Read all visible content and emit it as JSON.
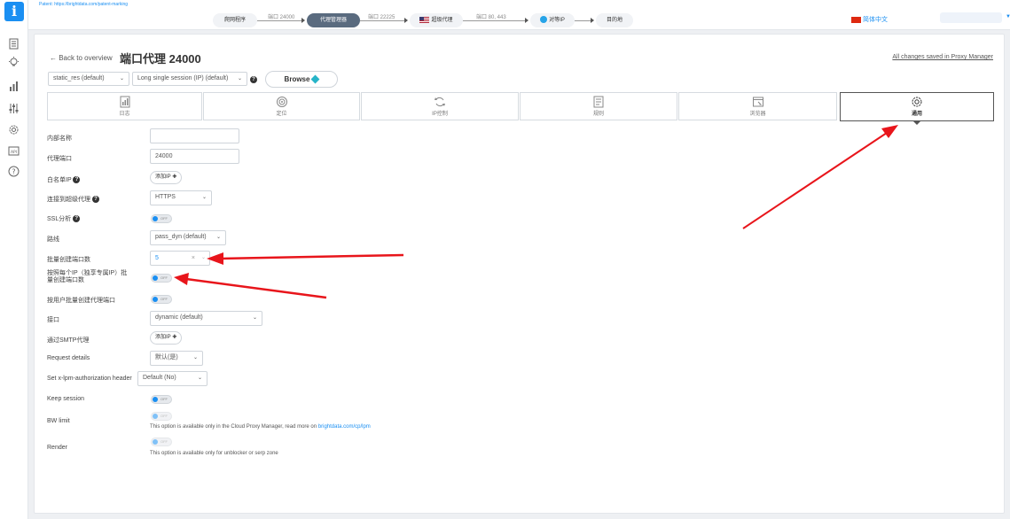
{
  "colors": {
    "accent": "#1a8ff2",
    "active_step": "#5a6b7f",
    "annotation": "#e8151b"
  },
  "topbar": {
    "patent": "Patent: https://brightdata.com/patent-marking",
    "steps": [
      "爬网程序",
      "代理管理器",
      "超级代理",
      "对等IP",
      "目的地"
    ],
    "ports": [
      "端口 24000",
      "端口 22225",
      "端口 80, 443"
    ],
    "language": "简体中文"
  },
  "header": {
    "back": "← Back to overview",
    "title": "端口代理 24000",
    "saved": "All changes saved in Proxy Manager"
  },
  "controls": {
    "zone": "static_res (default)",
    "session": "Long single session (IP) (default)",
    "help": "?",
    "browse": "Browse"
  },
  "tabs": [
    "日志",
    "定位",
    "IP控制",
    "规则",
    "浏览器",
    "通用"
  ],
  "form": {
    "internal_name": {
      "label": "内部名称",
      "value": ""
    },
    "proxy_port": {
      "label": "代理端口",
      "value": "24000"
    },
    "whitelist_ip": {
      "label": "白名单IP",
      "button": "添加IP ✚"
    },
    "connect_super": {
      "label": "连接到超级代理",
      "value": "HTTPS"
    },
    "ssl": {
      "label": "SSL分析",
      "toggle": "OFF"
    },
    "route": {
      "label": "路线",
      "value": "pass_dyn (default)"
    },
    "multiply": {
      "label": "批量创建端口数",
      "value": "5",
      "clear": "×"
    },
    "multiply_ip_1": "按照每个IP（独享专属IP）批",
    "multiply_ip_2": "量创建端口数",
    "multiply_user": {
      "label": "按用户批量创建代理端口",
      "toggle": "OFF"
    },
    "iface": {
      "label": "接口",
      "value": "dynamic (default)"
    },
    "smtp": {
      "label": "通过SMTP代理",
      "button": "添加IP ✚"
    },
    "req_details": {
      "label": "Request details",
      "value": "默认(是)"
    },
    "lpm_auth": {
      "label": "Set x-lpm-authorization header",
      "value": "Default (No)"
    },
    "keep_session": {
      "label": "Keep session",
      "toggle": "OFF"
    },
    "bw_limit": {
      "label": "BW limit",
      "toggle": "OFF",
      "note": "This option is available only in the Cloud Proxy Manager, read more on",
      "link": "brightdata.com/cp/lpm"
    },
    "render": {
      "label": "Render",
      "toggle": "OFF",
      "note": "This option is available only for unblocker or serp zone"
    }
  }
}
